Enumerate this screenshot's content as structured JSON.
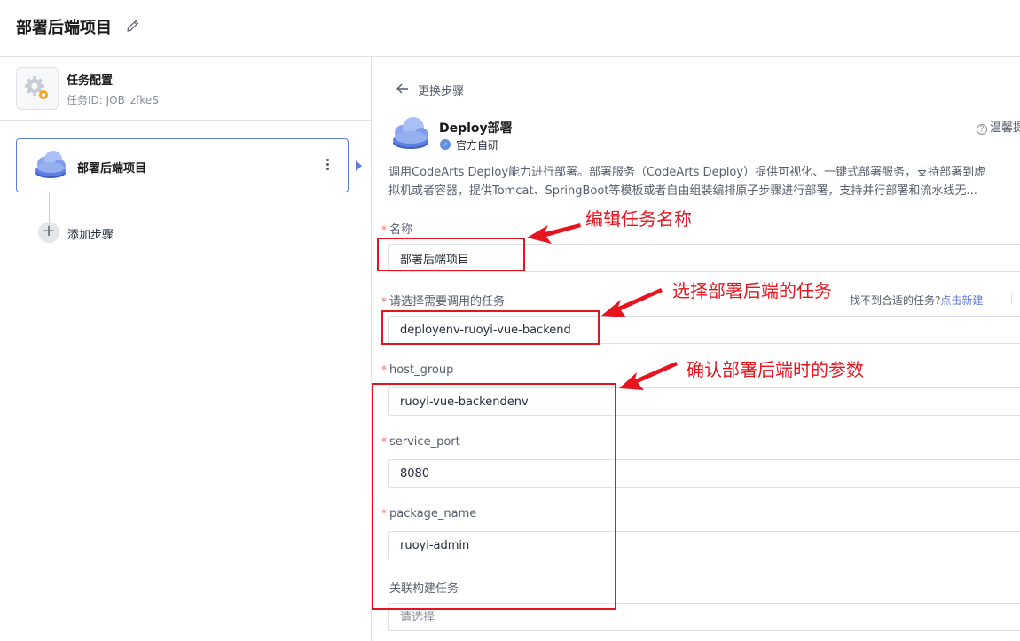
{
  "header": {
    "title": "部署后端项目"
  },
  "task": {
    "name": "任务配置",
    "id": "任务ID: JOB_zfkeS"
  },
  "step": {
    "label": "部署后端项目"
  },
  "add_step": {
    "label": "添加步骤"
  },
  "back": {
    "label": "更换步骤"
  },
  "plugin": {
    "name": "Deploy部署",
    "badge": "官方自研",
    "tips": "温馨提",
    "description_line1": "调用CodeArts Deploy能力进行部署。部署服务（CodeArts Deploy）提供可视化、一键式部署服务，支持部署到虚",
    "description_line2": "拟机或者容器，提供Tomcat、SpringBoot等模板或者自由组装编排原子步骤进行部署，支持并行部署和流水线无..."
  },
  "form": {
    "name_label": "名称",
    "name_value": "部署后端项目",
    "task_label": "请选择需要调用的任务",
    "task_value": "deployenv-ruoyi-vue-backend",
    "not_found_text": "找不到合适的任务?",
    "create_link": "点击新建",
    "host_group_label": "host_group",
    "host_group_value": "ruoyi-vue-backendenv",
    "service_port_label": "service_port",
    "service_port_value": "8080",
    "package_name_label": "package_name",
    "package_name_value": "ruoyi-admin",
    "build_task_label": "关联构建任务",
    "build_task_placeholder": "请选择"
  },
  "annotations": {
    "edit_name": "编辑任务名称",
    "select_task": "选择部署后端的任务",
    "confirm_params": "确认部署后端时的参数",
    "color": "#e5141e"
  },
  "colors": {
    "accent": "#5e7ce0",
    "required": "#f66f6a"
  }
}
